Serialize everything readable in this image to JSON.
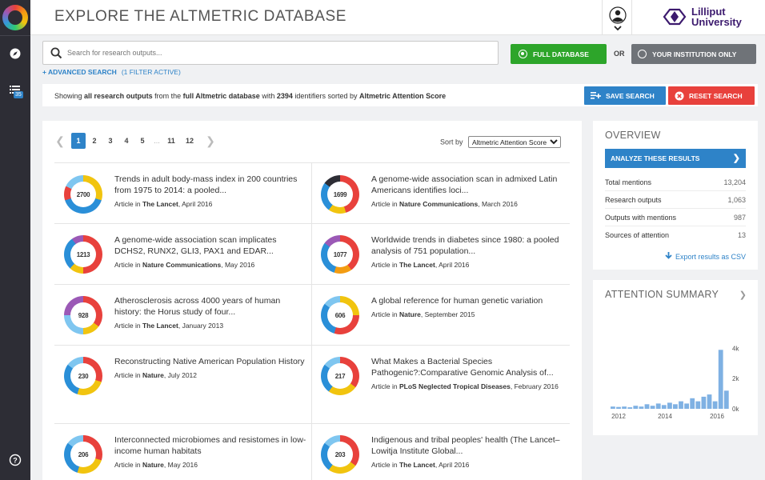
{
  "page": {
    "title": "EXPLORE THE ALTMETRIC DATABASE",
    "institution": "Lilliput University",
    "institution_line1": "Lilliput",
    "institution_line2": "University"
  },
  "rail": {
    "badge": "35"
  },
  "search": {
    "placeholder": "Search for research outputs...",
    "full_database_label": "FULL DATABASE",
    "or_label": "OR",
    "institution_only_label": "YOUR INSTITUTION ONLY",
    "selected_scope": "FULL DATABASE"
  },
  "advanced": {
    "label": "+ ADVANCED SEARCH",
    "filters": "(1 FILTER ACTIVE)"
  },
  "summary": {
    "prefix": "Showing",
    "scope": "all research outputs",
    "mid1": "from the",
    "db": "full Altmetric database",
    "mid2": "with",
    "count": "2394",
    "mid3": "identifiers sorted by",
    "sort": "Altmetric Attention Score"
  },
  "actions": {
    "save": "SAVE SEARCH",
    "reset": "RESET SEARCH"
  },
  "pagination": {
    "pages": [
      "1",
      "2",
      "3",
      "4",
      "5",
      "11",
      "12"
    ],
    "current": "1",
    "ellipsis": "..."
  },
  "sort": {
    "label": "Sort by",
    "value": "Altmetric Attention Score"
  },
  "results": [
    {
      "score": "2700",
      "title": "Trends in adult body-mass index in 200 countries from 1975 to 2014: a pooled...",
      "type": "Article in",
      "journal": "The Lancet",
      "date": ", April 2016"
    },
    {
      "score": "1699",
      "title": "A genome-wide association scan in admixed Latin Americans identifies loci...",
      "type": "Article in",
      "journal": "Nature Communications",
      "date": ", March 2016"
    },
    {
      "score": "1213",
      "title": "A genome-wide association scan implicates DCHS2, RUNX2, GLI3, PAX1 and EDAR...",
      "type": "Article in",
      "journal": "Nature Communications",
      "date": ", May 2016"
    },
    {
      "score": "1077",
      "title": "Worldwide trends in diabetes since 1980: a pooled analysis of 751 population...",
      "type": "Article in",
      "journal": "The Lancet",
      "date": ", April 2016"
    },
    {
      "score": "928",
      "title": "Atherosclerosis across 4000 years of human history: the Horus study of four...",
      "type": "Article in",
      "journal": "The Lancet",
      "date": ", January 2013"
    },
    {
      "score": "606",
      "title": "A global reference for human genetic variation",
      "type": "Article in",
      "journal": "Nature",
      "date": ", September 2015"
    },
    {
      "score": "230",
      "title": "Reconstructing Native American Population History",
      "type": "Article in",
      "journal": "Nature",
      "date": ", July 2012"
    },
    {
      "score": "217",
      "title": "What Makes a Bacterial Species Pathogenic?:Comparative Genomic Analysis of...",
      "type": "Article in",
      "journal": "PLoS Neglected Tropical Diseases",
      "date": ", February 2016"
    },
    {
      "score": "206",
      "title": "Interconnected microbiomes and resistomes in low-income human habitats",
      "type": "Article in",
      "journal": "Nature",
      "date": ", May 2016"
    },
    {
      "score": "203",
      "title": "Indigenous and tribal peoples' health (The Lancet–Lowitja Institute Global...",
      "type": "Article in",
      "journal": "The Lancet",
      "date": ", April 2016"
    }
  ],
  "overview": {
    "title": "OVERVIEW",
    "analyze": "ANALYZE THESE RESULTS",
    "stats": [
      {
        "label": "Total mentions",
        "value": "13,204"
      },
      {
        "label": "Research outputs",
        "value": "1,063"
      },
      {
        "label": "Outputs with mentions",
        "value": "987"
      },
      {
        "label": "Sources of attention",
        "value": "13"
      }
    ],
    "export": "Export results as CSV"
  },
  "attention": {
    "title": "ATTENTION SUMMARY"
  },
  "chart_data": {
    "type": "bar",
    "x_ticks": [
      "2012",
      "2014",
      "2016"
    ],
    "y_ticks": [
      "0k",
      "2k",
      "4k"
    ],
    "ylim": [
      0,
      4500
    ],
    "values": [
      150,
      120,
      150,
      100,
      200,
      150,
      300,
      200,
      350,
      250,
      400,
      300,
      500,
      350,
      700,
      500,
      800,
      950,
      500,
      3900,
      1200
    ],
    "color": "#7fb1e3"
  },
  "colors": {
    "accent": "#2e83c8",
    "green": "#2da52a",
    "red": "#e8413c",
    "rail": "#2d2d35"
  }
}
